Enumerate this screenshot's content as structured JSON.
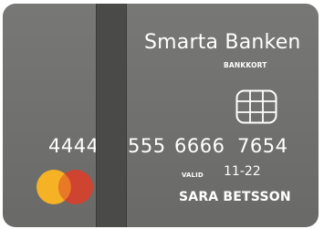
{
  "card": {
    "bank_name": "Smarta Banken",
    "card_type": "BANKKORT",
    "number_groups": [
      "4444",
      "555",
      "6666",
      "7654"
    ],
    "valid_label": "VALID",
    "valid_value": "11-22",
    "holder": "SARA BETSSON",
    "colors": {
      "card_body": "#6f6f6d",
      "stripe": "#4a4a49",
      "text": "#ffffff",
      "logo_left": "#f4b224",
      "logo_right": "#d8402c"
    },
    "icons": [
      "chip-icon",
      "mastercard-logo"
    ]
  }
}
